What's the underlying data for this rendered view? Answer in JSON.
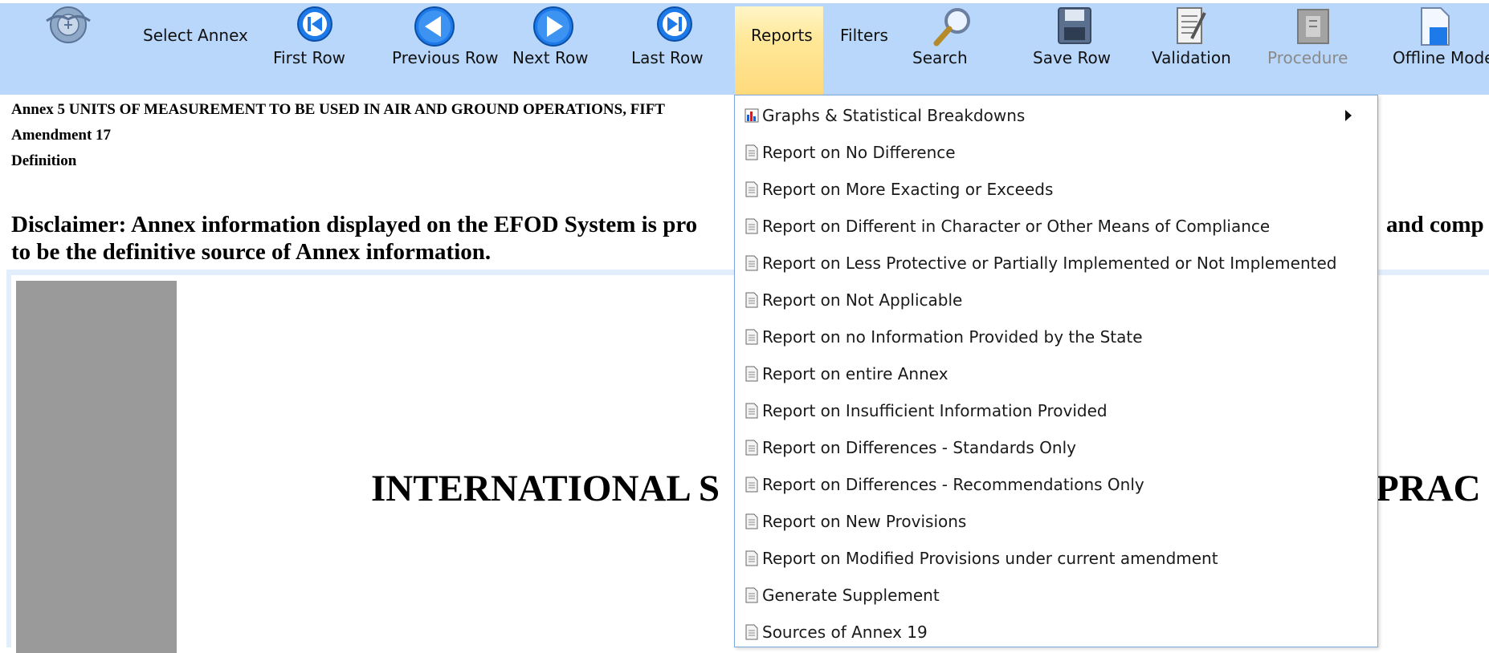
{
  "toolbar": {
    "select_annex": "Select Annex",
    "first_row": "First Row",
    "previous_row": "Previous Row",
    "next_row": "Next Row",
    "last_row": "Last Row",
    "reports": "Reports",
    "filters": "Filters",
    "search": "Search",
    "save_row": "Save Row",
    "validation": "Validation",
    "procedure": "Procedure",
    "offline_mode": "Offline Mode",
    "accent_color": "#b9d7fb",
    "active_tab_color": "#ffe89a",
    "nav_icon_color": "#1e7ae8"
  },
  "document": {
    "annex_title": "Annex 5 UNITS OF MEASUREMENT TO BE USED IN AIR AND GROUND OPERATIONS, FIFT",
    "amendment": "Amendment 17",
    "section": "Definition",
    "disclaimer_line1_left": "Disclaimer: Annex information displayed on the EFOD System is pro",
    "disclaimer_line1_right": "and comp",
    "disclaimer_line2": "to be the definitive source of Annex information.",
    "page_title_left": "INTERNATIONAL S",
    "page_title_right": "PRAC"
  },
  "reports_menu": {
    "items": [
      {
        "label": "Graphs & Statistical Breakdowns",
        "icon": "chart-icon",
        "has_submenu": true
      },
      {
        "label": "Report on No Difference",
        "icon": "document-icon"
      },
      {
        "label": "Report on More Exacting or Exceeds",
        "icon": "document-icon"
      },
      {
        "label": "Report on Different in Character or Other Means of Compliance",
        "icon": "document-icon"
      },
      {
        "label": "Report on Less Protective or Partially Implemented or Not Implemented",
        "icon": "document-icon"
      },
      {
        "label": "Report on Not Applicable",
        "icon": "document-icon"
      },
      {
        "label": "Report on no Information Provided by the State",
        "icon": "document-icon"
      },
      {
        "label": "Report on entire Annex",
        "icon": "document-icon"
      },
      {
        "label": "Report on Insufficient Information Provided",
        "icon": "document-icon"
      },
      {
        "label": "Report on Differences - Standards Only",
        "icon": "document-icon"
      },
      {
        "label": "Report on Differences - Recommendations Only",
        "icon": "document-icon"
      },
      {
        "label": "Report on New Provisions",
        "icon": "document-icon"
      },
      {
        "label": "Report on Modified Provisions under current amendment",
        "icon": "document-icon"
      },
      {
        "label": "Generate Supplement",
        "icon": "document-icon"
      },
      {
        "label": "Sources of Annex 19",
        "icon": "document-icon"
      }
    ]
  }
}
